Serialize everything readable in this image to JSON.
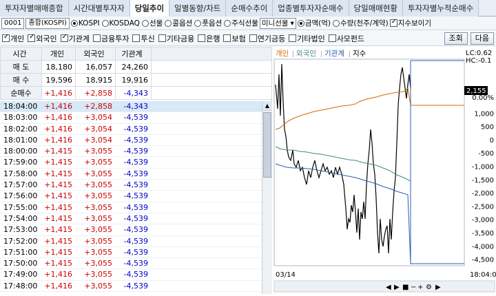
{
  "tabs": [
    "투자자별매매종합",
    "시간대별투자자",
    "당일추이",
    "일별동향/차트",
    "순매수추이",
    "업종별투자자순매수",
    "당일매매현황",
    "투자자별누적순매수"
  ],
  "toolbar": {
    "code": "0001",
    "index_name": "종합(KOSPI)",
    "market_options": [
      "KOSPI",
      "KOSDAQ",
      "선물",
      "콜옵션",
      "풋옵션",
      "주식선물"
    ],
    "market_selected": "KOSPI",
    "futures_select": "미니선물",
    "unit_options": [
      "금액(억)",
      "수량(천주/계약)"
    ],
    "unit_selected": "금액(억)",
    "show_index_label": "지수보이기"
  },
  "filters": {
    "items": [
      {
        "label": "개인",
        "checked": true
      },
      {
        "label": "외국인",
        "checked": true
      },
      {
        "label": "기관계",
        "checked": true
      },
      {
        "label": "금융투자",
        "checked": false
      },
      {
        "label": "투신",
        "checked": false
      },
      {
        "label": "기타금융",
        "checked": false
      },
      {
        "label": "은행",
        "checked": false
      },
      {
        "label": "보험",
        "checked": false
      },
      {
        "label": "연기금등",
        "checked": false
      },
      {
        "label": "기타법인",
        "checked": false
      },
      {
        "label": "사모펀드",
        "checked": false
      }
    ],
    "query_button": "조회",
    "next_button": "다음"
  },
  "summary": {
    "headers": [
      "시간",
      "개인",
      "외국인",
      "기관계"
    ],
    "rows": [
      {
        "label": "매 도",
        "v": [
          "18,180",
          "16,057",
          "24,260"
        ]
      },
      {
        "label": "매 수",
        "v": [
          "19,596",
          "18,915",
          "19,916"
        ]
      },
      {
        "label": "순매수",
        "v": [
          "+1,416",
          "+2,858",
          "-4,343"
        ]
      }
    ]
  },
  "grid": [
    [
      "18:04:00",
      "+1,416",
      "+2,858",
      "-4,343"
    ],
    [
      "18:03:00",
      "+1,416",
      "+3,054",
      "-4,539"
    ],
    [
      "18:02:00",
      "+1,416",
      "+3,054",
      "-4,539"
    ],
    [
      "18:01:00",
      "+1,416",
      "+3,054",
      "-4,539"
    ],
    [
      "18:00:00",
      "+1,415",
      "+3,055",
      "-4,539"
    ],
    [
      "17:59:00",
      "+1,415",
      "+3,055",
      "-4,539"
    ],
    [
      "17:58:00",
      "+1,415",
      "+3,055",
      "-4,539"
    ],
    [
      "17:57:00",
      "+1,415",
      "+3,055",
      "-4,539"
    ],
    [
      "17:56:00",
      "+1,415",
      "+3,055",
      "-4,539"
    ],
    [
      "17:55:00",
      "+1,415",
      "+3,055",
      "-4,539"
    ],
    [
      "17:54:00",
      "+1,415",
      "+3,055",
      "-4,539"
    ],
    [
      "17:53:00",
      "+1,415",
      "+3,055",
      "-4,539"
    ],
    [
      "17:52:00",
      "+1,415",
      "+3,055",
      "-4,539"
    ],
    [
      "17:51:00",
      "+1,415",
      "+3,055",
      "-4,539"
    ],
    [
      "17:50:00",
      "+1,415",
      "+3,055",
      "-4,539"
    ],
    [
      "17:49:00",
      "+1,416",
      "+3,055",
      "-4,539"
    ],
    [
      "17:48:00",
      "+1,416",
      "+3,055",
      "-4,539"
    ]
  ],
  "chart": {
    "legend": [
      "개인",
      "외국인",
      "기관계",
      "지수"
    ],
    "legend_colors": [
      "#d06a00",
      "#3a8a86",
      "#2a5db0",
      "#000000"
    ],
    "top_labels": [
      "LC:0.62",
      "HC:-0.1"
    ],
    "index_value": "2,155",
    "yaxis": [
      "0.00%",
      "1,000",
      "500",
      "0",
      "-500",
      "-1,000",
      "-1,500",
      "-2,000",
      "-2,500",
      "-3,000",
      "-3,500",
      "-4,000",
      "-4,500"
    ],
    "x_start": "03/14",
    "x_end": "18:04:0"
  }
}
